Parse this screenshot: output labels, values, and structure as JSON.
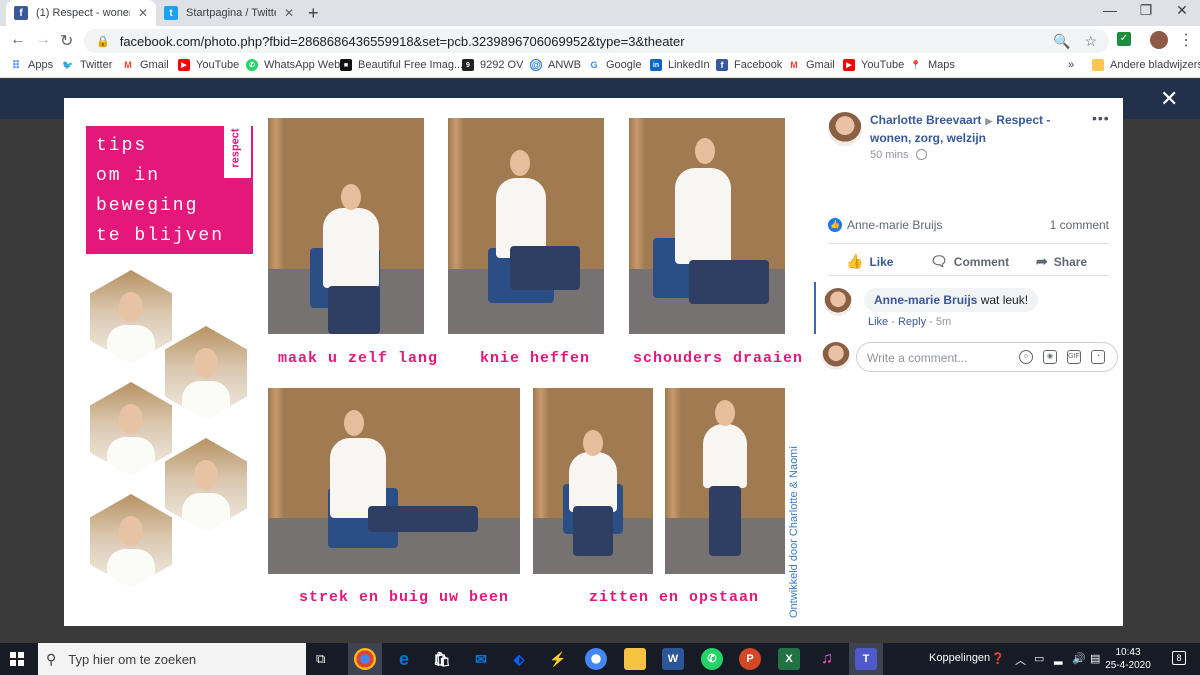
{
  "browser": {
    "tabs": [
      {
        "title": "(1) Respect - wonen, zo",
        "close": "✕"
      },
      {
        "title": "Startpagina / Twitter",
        "close": "✕"
      }
    ],
    "new_tab": "+",
    "window": {
      "minimize": "—",
      "maximize": "❐",
      "close": "✕"
    },
    "url": "facebook.com/photo.php?fbid=2868686436559918&set=pcb.3239896706069952&type=3&theater",
    "bookmarks": [
      {
        "label": "Apps",
        "icon": "apps-grid-icon"
      },
      {
        "label": "Twitter",
        "icon": "twitter-icon"
      },
      {
        "label": "Gmail",
        "icon": "gmail-icon"
      },
      {
        "label": "YouTube",
        "icon": "youtube-icon"
      },
      {
        "label": "WhatsApp Web",
        "icon": "whatsapp-icon"
      },
      {
        "label": "Beautiful Free Imag...",
        "icon": "unsplash-icon"
      },
      {
        "label": "9292 OV",
        "icon": "9292-icon"
      },
      {
        "label": "ANWB",
        "icon": "anwb-icon"
      },
      {
        "label": "Google",
        "icon": "google-icon"
      },
      {
        "label": "LinkedIn",
        "icon": "linkedin-icon"
      },
      {
        "label": "Facebook",
        "icon": "facebook-icon"
      },
      {
        "label": "Gmail",
        "icon": "gmail-icon"
      },
      {
        "label": "YouTube",
        "icon": "youtube-icon"
      },
      {
        "label": "Maps",
        "icon": "maps-icon"
      }
    ],
    "bookmarks_overflow": "»",
    "other_bookmarks": "Andere bladwijzers"
  },
  "photo": {
    "title_lines": [
      "tips",
      "om in",
      "beweging",
      "te blijven"
    ],
    "logo": "respect",
    "captions": [
      "maak u zelf lang",
      "knie heffen",
      "schouders draaien",
      "strek en buig uw been",
      "zitten en opstaan"
    ],
    "credit": "Ontwikkeld door Charlotte & Naomi"
  },
  "post": {
    "author": "Charlotte Breevaart",
    "page": "Respect - wonen, zorg, welzijn",
    "time": "50 mins",
    "more": "•••",
    "reaction_name": "Anne-marie Bruijs",
    "comment_count": "1 comment",
    "actions": {
      "like": "Like",
      "comment": "Comment",
      "share": "Share"
    },
    "comment": {
      "author": "Anne-marie Bruijs",
      "text": "wat leuk!",
      "like": "Like",
      "reply": "Reply",
      "age": "5m"
    },
    "write_placeholder": "Write a comment..."
  },
  "taskbar": {
    "search_placeholder": "Typ hier om te zoeken",
    "links_label": "Koppelingen",
    "time": "10:43",
    "date": "25-4-2020",
    "notifications": "8"
  },
  "colors": {
    "accent_pink": "#e4177a",
    "facebook_blue": "#385898"
  }
}
